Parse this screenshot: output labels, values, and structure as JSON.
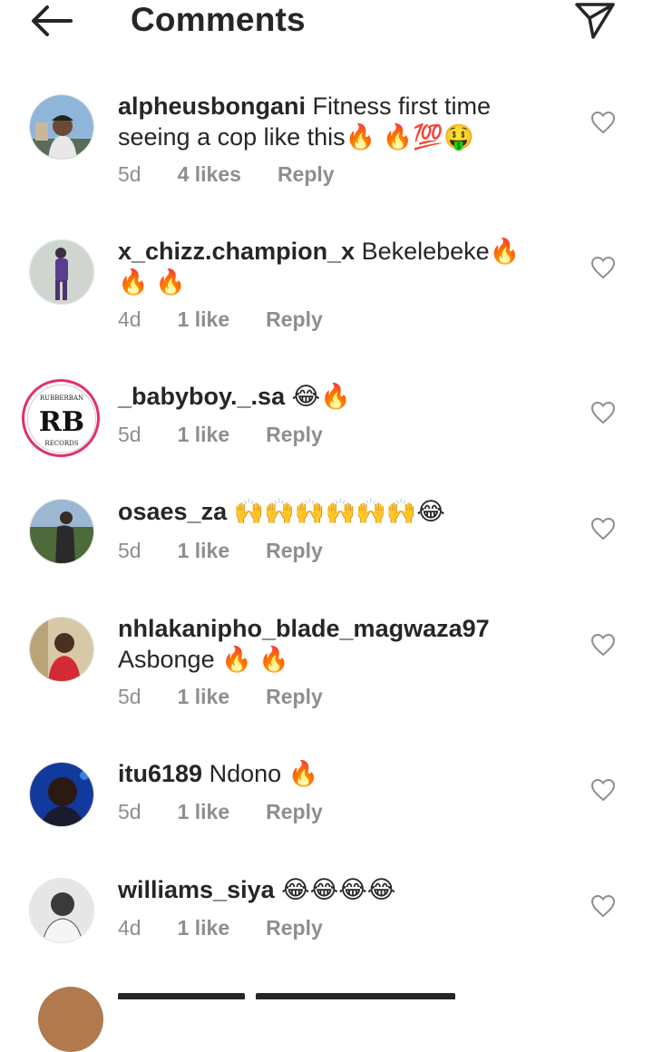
{
  "header": {
    "title": "Comments",
    "back_icon": "arrow-left-icon",
    "send_icon": "paper-plane-icon"
  },
  "colors": {
    "text": "#262626",
    "secondary": "#8e8e8e",
    "avatar_ring": "#e1306c"
  },
  "comments": [
    {
      "username": "alpheusbongani",
      "text": " Fitness first time seeing a cop like this🔥 🔥💯🤑",
      "time": "5d",
      "likes": "4 likes",
      "reply": "Reply"
    },
    {
      "username": "x_chizz.champion_x",
      "text": " Bekelebeke🔥 🔥 🔥",
      "time": "4d",
      "likes": "1 like",
      "reply": "Reply"
    },
    {
      "username": "_babyboy._.sa",
      "text": " 😂🔥",
      "time": "5d",
      "likes": "1 like",
      "reply": "Reply",
      "avatar_text": {
        "top": "RUBBERBAN",
        "mono": "RB",
        "bottom": "RECORDS"
      }
    },
    {
      "username": "osaes_za",
      "text": " 🙌🙌🙌🙌🙌🙌😂",
      "time": "5d",
      "likes": "1 like",
      "reply": "Reply"
    },
    {
      "username": "nhlakanipho_blade_magwaza97",
      "text": " Asbonge 🔥 🔥",
      "time": "5d",
      "likes": "1 like",
      "reply": "Reply"
    },
    {
      "username": "itu6189",
      "text": " Ndono 🔥",
      "time": "5d",
      "likes": "1 like",
      "reply": "Reply"
    },
    {
      "username": "williams_siya",
      "text": " 😂😂😂😂",
      "time": "4d",
      "likes": "1 like",
      "reply": "Reply"
    }
  ]
}
